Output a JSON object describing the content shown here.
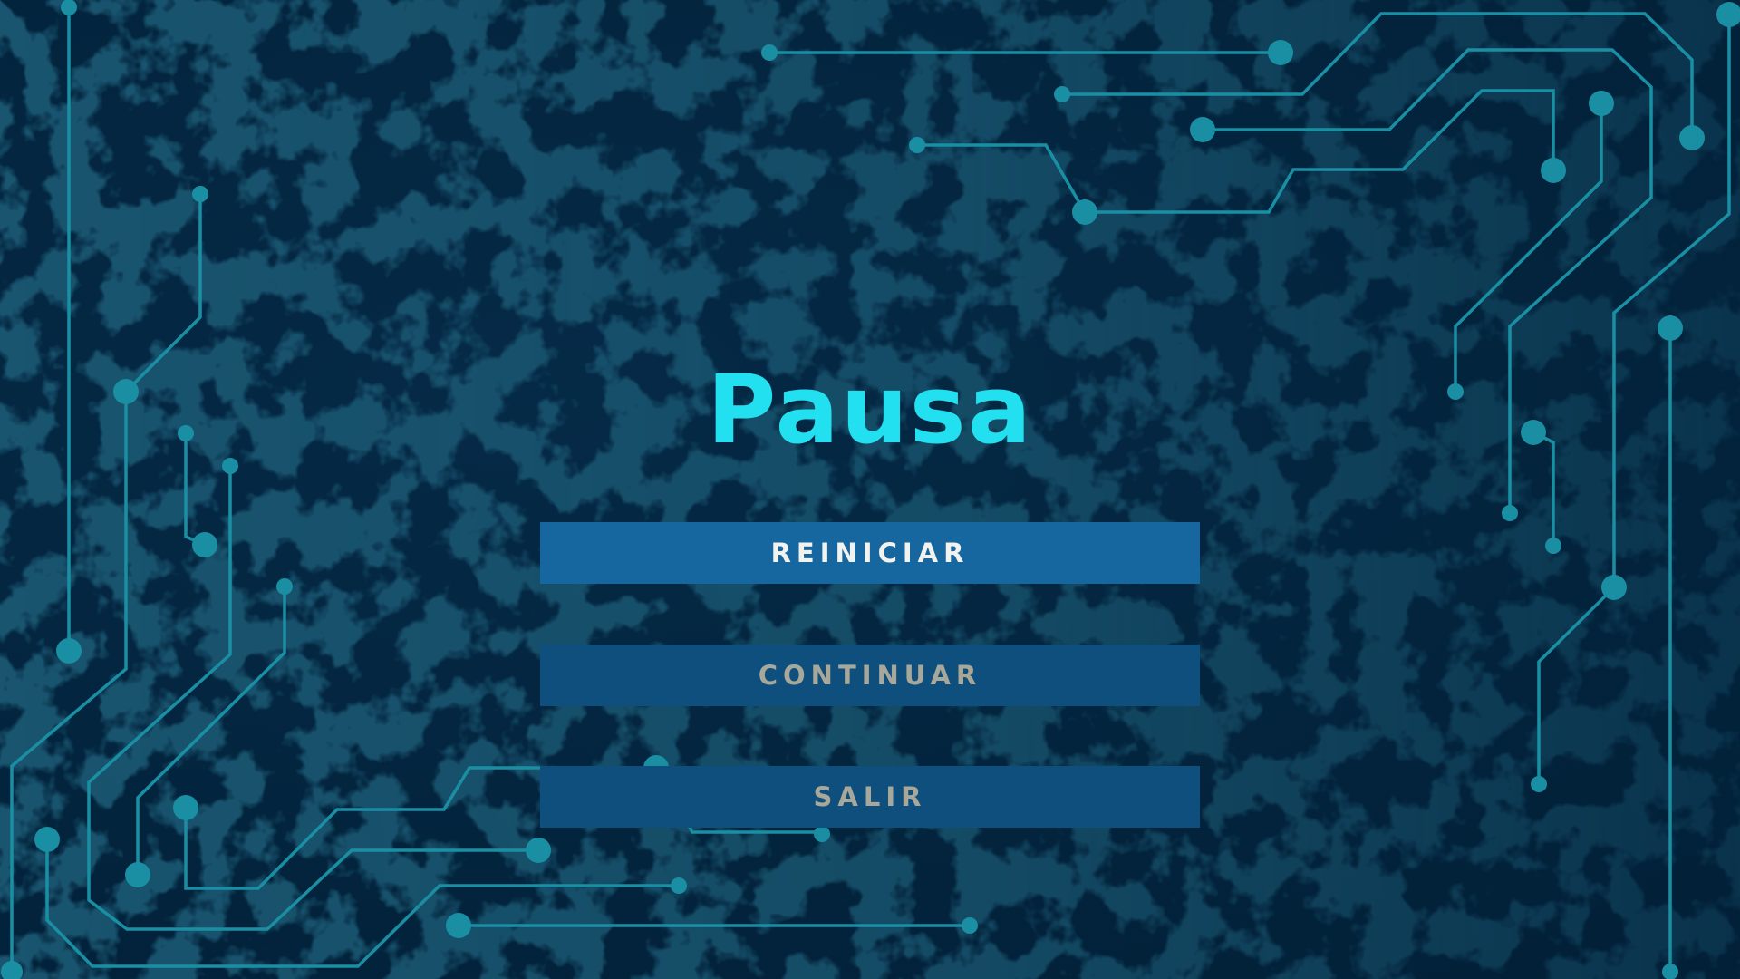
{
  "pause_menu": {
    "title": "Pausa",
    "buttons": [
      {
        "label": "REINICIAR",
        "state": "selected"
      },
      {
        "label": "CONTINUAR",
        "state": "idle"
      },
      {
        "label": "SALIR",
        "state": "idle"
      }
    ]
  },
  "theme": {
    "background": "#042640",
    "circuit_color": "#1a8fa3",
    "title_color": "#22e0f0",
    "button_selected_color": "#16679f",
    "button_idle_color": "#0f4f7e"
  }
}
